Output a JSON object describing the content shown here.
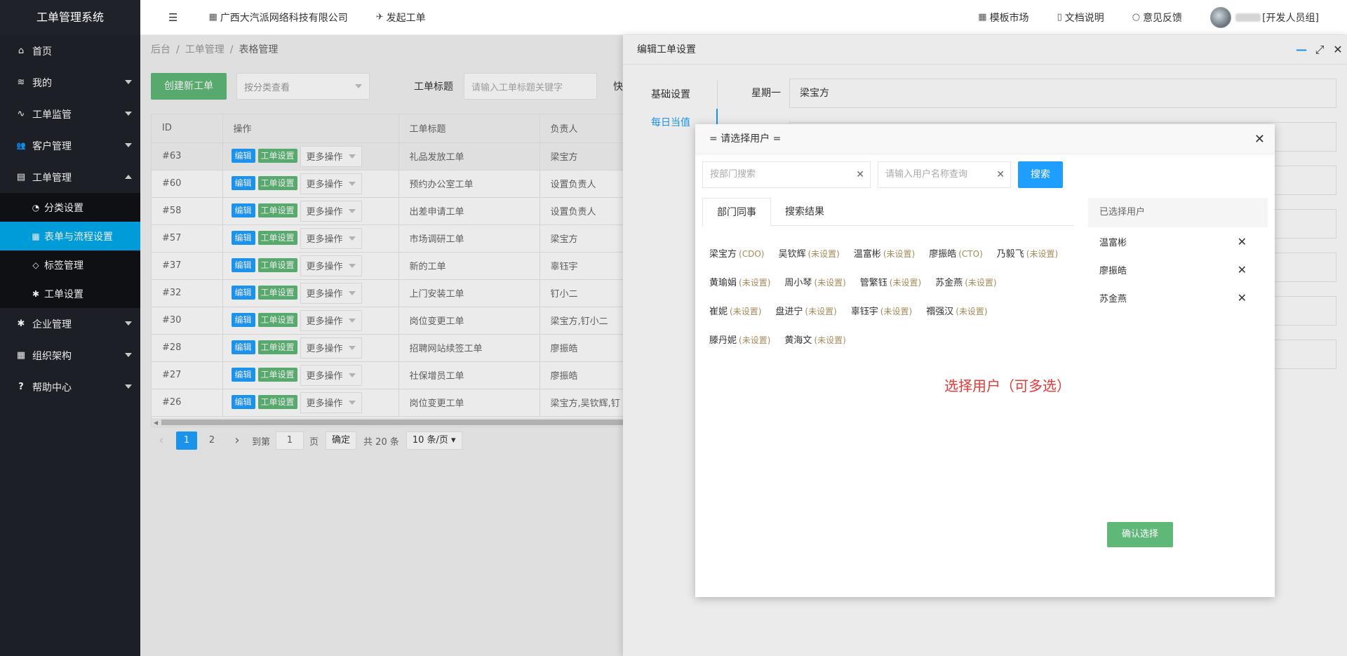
{
  "app_title": "工单管理系统",
  "sidebar": {
    "items": [
      {
        "label": "首页",
        "icon": "home-icon",
        "glyph": "⌂"
      },
      {
        "label": "我的",
        "icon": "layers-icon",
        "glyph": "≋"
      },
      {
        "label": "工单监管",
        "icon": "pulse-icon",
        "glyph": "∿"
      },
      {
        "label": "客户管理",
        "icon": "users-icon",
        "glyph": "👥"
      },
      {
        "label": "工单管理",
        "icon": "clipboard-icon",
        "glyph": "▤"
      }
    ],
    "sub_items": [
      {
        "label": "分类设置",
        "icon": "category-icon",
        "glyph": "◔"
      },
      {
        "label": "表单与流程设置",
        "icon": "grid-icon",
        "glyph": "▦"
      },
      {
        "label": "标签管理",
        "icon": "tag-icon",
        "glyph": "◇"
      },
      {
        "label": "工单设置",
        "icon": "gear-icon",
        "glyph": "✱"
      }
    ],
    "items_after": [
      {
        "label": "企业管理",
        "icon": "gear-icon",
        "glyph": "✱"
      },
      {
        "label": "组织架构",
        "icon": "org-icon",
        "glyph": "▦"
      },
      {
        "label": "帮助中心",
        "icon": "help-icon",
        "glyph": "?"
      }
    ]
  },
  "header": {
    "menu_icon": "☰",
    "company": "广西大汽派网络科技有限公司",
    "launch": "发起工单",
    "template_market": "模板市场",
    "docs": "文档说明",
    "feedback": "意见反馈",
    "user_suffix": "[开发人员组]"
  },
  "breadcrumb": {
    "root": "后台",
    "mid": "工单管理",
    "current": "表格管理",
    "sep": "/"
  },
  "toolbar": {
    "create": "创建新工单",
    "category_select": "按分类查看",
    "title_label": "工单标题",
    "title_placeholder": "请输入工单标题关键字",
    "cut_label": "快"
  },
  "table": {
    "headers": [
      "ID",
      "操作",
      "工单标题",
      "负责人"
    ],
    "edit_label": "编辑",
    "settings_label": "工单设置",
    "more_label": "更多操作",
    "rows": [
      {
        "id": "#63",
        "title": "礼品发放工单",
        "owner": "梁宝方"
      },
      {
        "id": "#60",
        "title": "预约办公室工单",
        "owner": "设置负责人"
      },
      {
        "id": "#58",
        "title": "出差申请工单",
        "owner": "设置负责人"
      },
      {
        "id": "#57",
        "title": "市场调研工单",
        "owner": "梁宝方"
      },
      {
        "id": "#37",
        "title": "新的工单",
        "owner": "辜钰宇"
      },
      {
        "id": "#32",
        "title": "上门安装工单",
        "owner": "钉小二"
      },
      {
        "id": "#30",
        "title": "岗位变更工单",
        "owner": "梁宝方,钉小二"
      },
      {
        "id": "#28",
        "title": "招聘网站续签工单",
        "owner": "廖振皓"
      },
      {
        "id": "#27",
        "title": "社保增员工单",
        "owner": "廖振皓"
      },
      {
        "id": "#26",
        "title": "岗位变更工单",
        "owner": "梁宝方,吴钦辉,钉"
      }
    ]
  },
  "pager": {
    "prev": "‹",
    "next": "›",
    "pages": [
      "1",
      "2"
    ],
    "goto": "到第",
    "goto_value": "1",
    "page_unit": "页",
    "confirm": "确定",
    "total": "共 20 条",
    "per_page": "10 条/页 ▾"
  },
  "drawer": {
    "title": "编辑工单设置",
    "tabs": [
      "基础设置",
      "每日当值"
    ],
    "row_label": "星期一",
    "row_value": "梁宝方"
  },
  "modal": {
    "title": "= 请选择用户 =",
    "dept_placeholder": "按部门搜索",
    "name_placeholder": "请输入用户名称查询",
    "search_btn": "搜索",
    "tabs": [
      "部门同事",
      "搜索结果"
    ],
    "users": [
      [
        {
          "name": "梁宝方",
          "role": "(CDO)"
        },
        {
          "name": "吴钦辉",
          "role": "(未设置)"
        },
        {
          "name": "温富彬",
          "role": "(未设置)"
        },
        {
          "name": "廖振皓",
          "role": "(CTO)"
        },
        {
          "name": "乃毅飞",
          "role": "(未设置)"
        }
      ],
      [
        {
          "name": "黄瑜娟",
          "role": "(未设置)"
        },
        {
          "name": "周小琴",
          "role": "(未设置)"
        },
        {
          "name": "管繁钰",
          "role": "(未设置)"
        },
        {
          "name": "苏金燕",
          "role": "(未设置)"
        }
      ],
      [
        {
          "name": "崔妮",
          "role": "(未设置)"
        },
        {
          "name": "盘进宁",
          "role": "(未设置)"
        },
        {
          "name": "辜钰宇",
          "role": "(未设置)"
        },
        {
          "name": "禤强汉",
          "role": "(未设置)"
        }
      ],
      [
        {
          "name": "滕丹妮",
          "role": "(未设置)"
        },
        {
          "name": "黄海文",
          "role": "(未设置)"
        }
      ]
    ],
    "hint": "选择用户（可多选）",
    "selected_title": "已选择用户",
    "selected": [
      "温富彬",
      "廖振皓",
      "苏金燕"
    ],
    "confirm": "确认选择"
  },
  "colors": {
    "sidebar_bg": "#20222a",
    "active_blue": "#01aaed",
    "primary_blue": "#1e9fff",
    "green": "#5fb878",
    "hint_red": "#e53935"
  }
}
